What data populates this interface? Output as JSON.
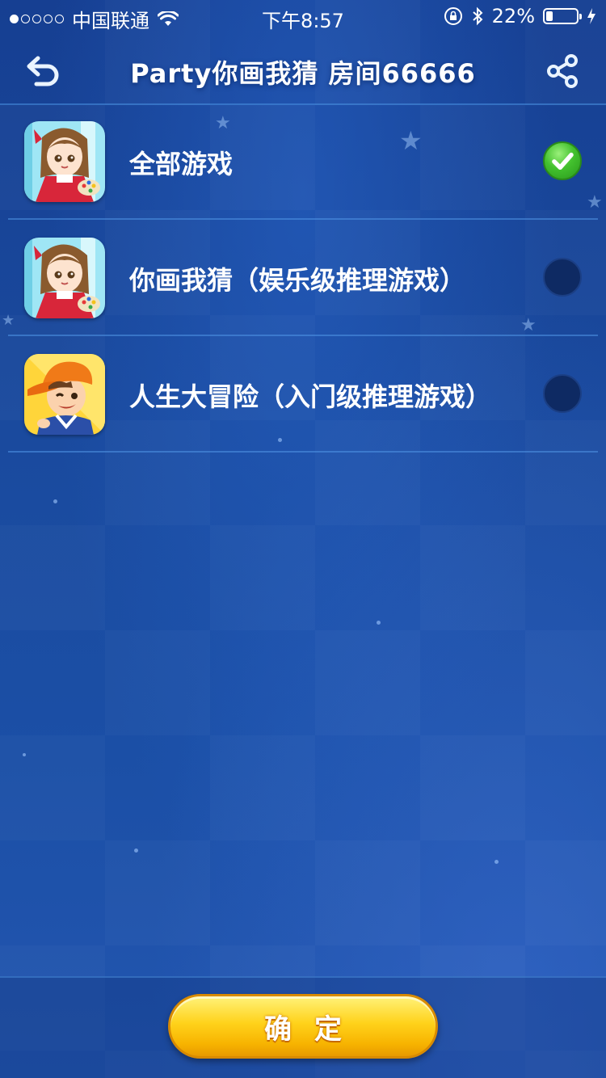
{
  "status_bar": {
    "carrier": "中国联通",
    "time": "下午8:57",
    "battery": "22%",
    "battery_level": 0.22
  },
  "header": {
    "title": "Party你画我猜 房间66666",
    "back_icon": "back-arrow-icon",
    "share_icon": "share-icon"
  },
  "games": [
    {
      "label": "全部游戏",
      "icon": "girl-painter-avatar",
      "selected": true
    },
    {
      "label": "你画我猜（娱乐级推理游戏）",
      "icon": "girl-painter-avatar",
      "selected": false
    },
    {
      "label": "人生大冒险（入门级推理游戏）",
      "icon": "boy-cap-avatar",
      "selected": false
    }
  ],
  "footer": {
    "confirm_label": "确定"
  },
  "colors": {
    "background": "#1a4a9e",
    "accent_green": "#43c12e",
    "button_yellow": "#ffd21a"
  }
}
